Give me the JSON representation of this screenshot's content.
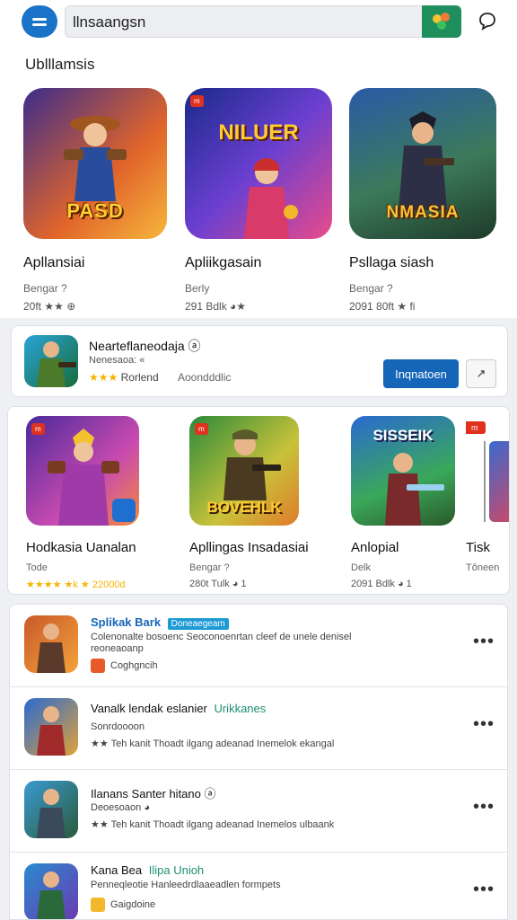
{
  "header": {
    "search_text": "llnsaangsn",
    "chat_icon": "chat-bubble-icon",
    "menu_icon": "menu-icon"
  },
  "top_section": {
    "title": "Ublllamsis",
    "cards": [
      {
        "art_text": "PASD",
        "name": "Apllansiai",
        "sub": "Bengar ?",
        "meta": "20ft ★★ ⊕"
      },
      {
        "art_text": "NILUER",
        "name": "Apliikgasain",
        "sub": "Berly",
        "meta": "291 Bdlk ◕★"
      },
      {
        "art_text": "NMASIA",
        "name": "Psllaga siash",
        "sub": "Bengar ?",
        "meta": "2091 80ft ★ fi"
      }
    ]
  },
  "featured": {
    "title": "Nearteflaneodaja ⓐ",
    "sub": "Nenesaoa: «",
    "rating_text": "Rorlend",
    "meta_extra": "Aoondddlic",
    "install_label": "Inqnatoen",
    "share_label": "↗"
  },
  "carousel": {
    "cards": [
      {
        "badge": "m",
        "name": "Hodkasia Uanalan",
        "sub": "Tode",
        "meta": "★★★★ ★k ★ 22000d"
      },
      {
        "badge": "m",
        "name": "Apllingas Insadasiai",
        "sub": "Bengar ?",
        "meta": "280t Tulk ◕ 1",
        "art_text": "BOVEHLK"
      },
      {
        "badge": "",
        "name": "Anlopial",
        "sub": "Delk",
        "meta": "2091 Bdlk ◕ 1",
        "art_text": "SISSEIK"
      },
      {
        "badge": "m",
        "name": "Tisk",
        "sub": "Tôneen",
        "meta": ""
      }
    ]
  },
  "list": {
    "rows": [
      {
        "title": "Splikak Bark",
        "tag": "Doneaegeam",
        "line1": "Colenonalte bosoenc Seoconoenrtan cleef de unele denisel",
        "line2": "reoneaoanp",
        "line3": "Coghgncih"
      },
      {
        "title": "Vanalk lendak eslanier",
        "tag": "Urikkanes",
        "line1": "Sonrdoooon",
        "line2": "★★ Teh kanit     Thoadt ilgang adeanad Inemelok ekangal"
      },
      {
        "title": "Ilanans Santer hitano ⓐ",
        "tag": "",
        "line1": "Deoesoaon ◕",
        "line2": "★★ Teh kanit     Thoadt ilgang adeanad Inemelos ulbaank"
      },
      {
        "title": "Kana Bea",
        "tag": "Ilipa Unioh",
        "line1": "Penneqleotie Hanleedrdlaaeadlen formpets",
        "line2": "Gaigdoine"
      }
    ]
  }
}
